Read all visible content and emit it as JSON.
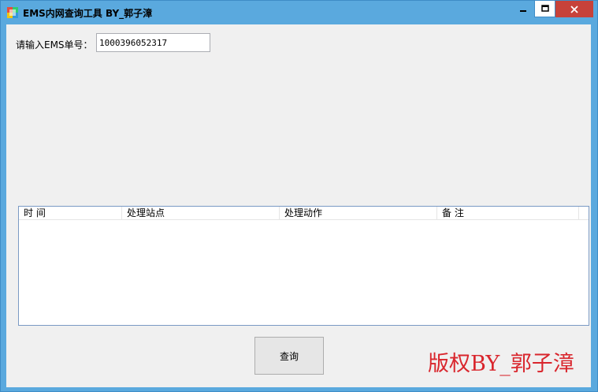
{
  "window": {
    "title": "EMS内网查询工具 BY_郭子漳",
    "minimize_glyph": "–",
    "maximize_glyph": "□",
    "close_glyph": "✕"
  },
  "form": {
    "ems_label": "请输入EMS单号：",
    "ems_value": "1000396052317"
  },
  "listview": {
    "columns": [
      "时 间",
      "处理站点",
      "处理动作",
      "备 注"
    ],
    "rows": []
  },
  "buttons": {
    "query_label": "查询"
  },
  "footer": {
    "copyright": "版权BY_郭子漳"
  },
  "colors": {
    "titlebar": "#5aa9de",
    "close_button": "#c7423a",
    "client_bg": "#f0f0f0",
    "copyright_text": "#d9262d"
  }
}
